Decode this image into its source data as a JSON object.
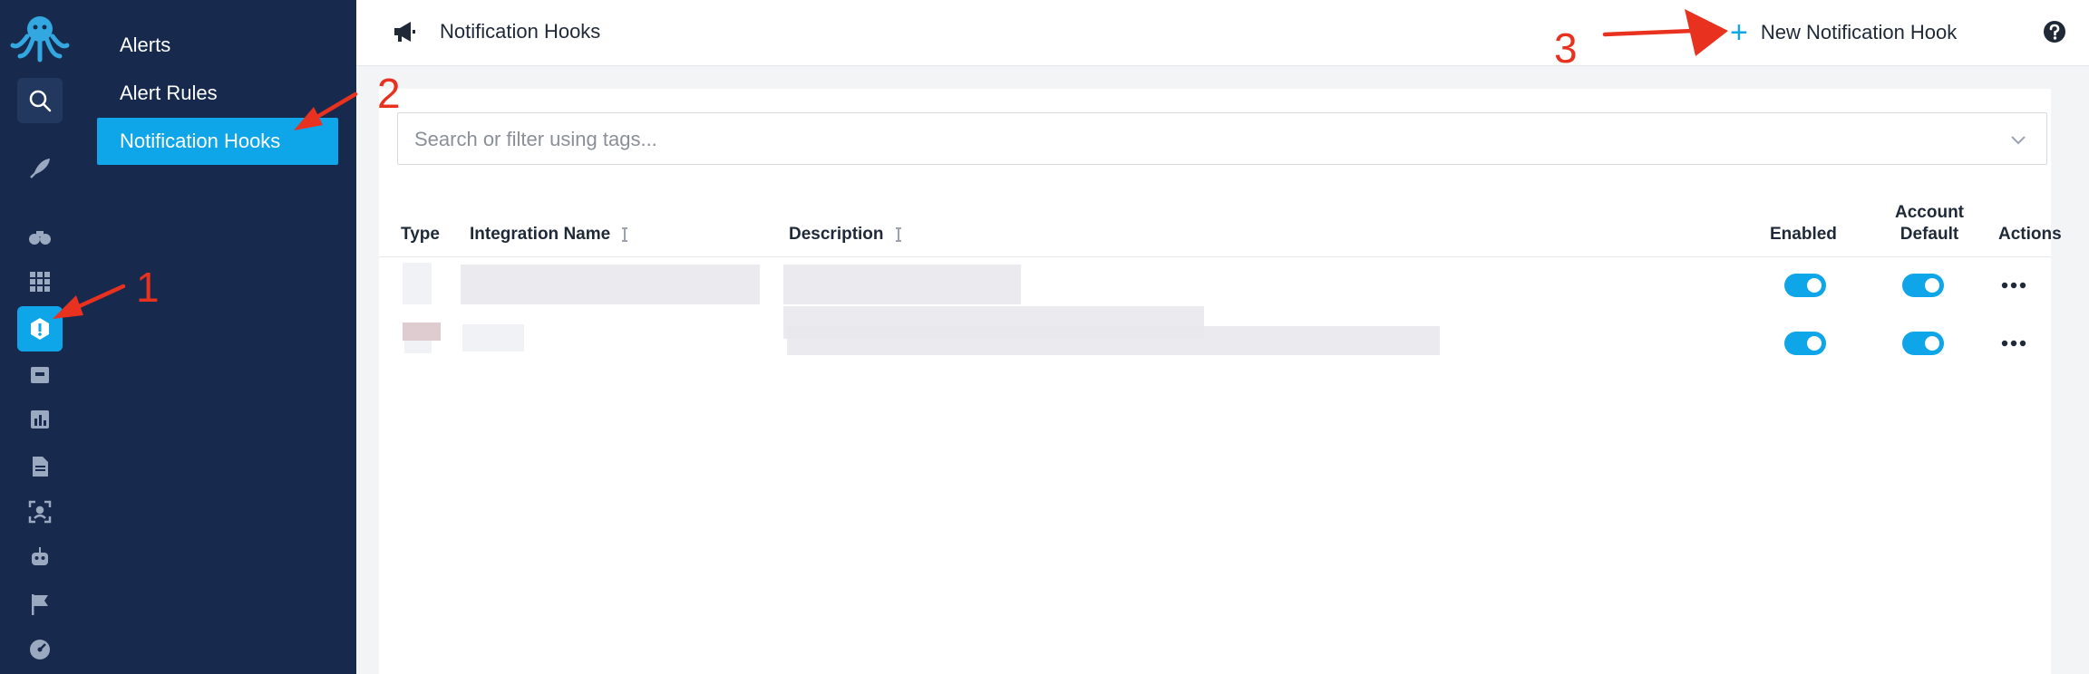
{
  "sidebar": {
    "icons": [
      "octopus-logo",
      "search-icon",
      "rocket-icon",
      "binoculars-icon",
      "grid-icon",
      "alert-icon",
      "inbox-icon",
      "chart-icon",
      "document-icon",
      "scan-icon",
      "robot-icon",
      "flag-icon",
      "dashboard-icon"
    ],
    "active_icon": "alert-icon"
  },
  "subnav": {
    "items": [
      {
        "label": "Alerts"
      },
      {
        "label": "Alert Rules"
      },
      {
        "label": "Notification Hooks"
      }
    ],
    "active_index": 2
  },
  "header": {
    "icon": "megaphone-icon",
    "title": "Notification Hooks",
    "new_hook_label": "New Notification Hook",
    "help_icon": "question-icon"
  },
  "search": {
    "placeholder": "Search or filter using tags...",
    "value": ""
  },
  "table": {
    "columns": {
      "type": "Type",
      "integration_name": "Integration Name",
      "description": "Description",
      "enabled": "Enabled",
      "account_default_line1": "Account",
      "account_default_line2": "Default",
      "actions": "Actions"
    },
    "rows": [
      {
        "enabled": true,
        "account_default": true
      },
      {
        "enabled": true,
        "account_default": true
      }
    ]
  },
  "annotations": [
    "1",
    "2",
    "3"
  ],
  "colors": {
    "sidebar_bg": "#17294d",
    "accent": "#0ea5e9",
    "annotation_red": "#e8321f"
  }
}
